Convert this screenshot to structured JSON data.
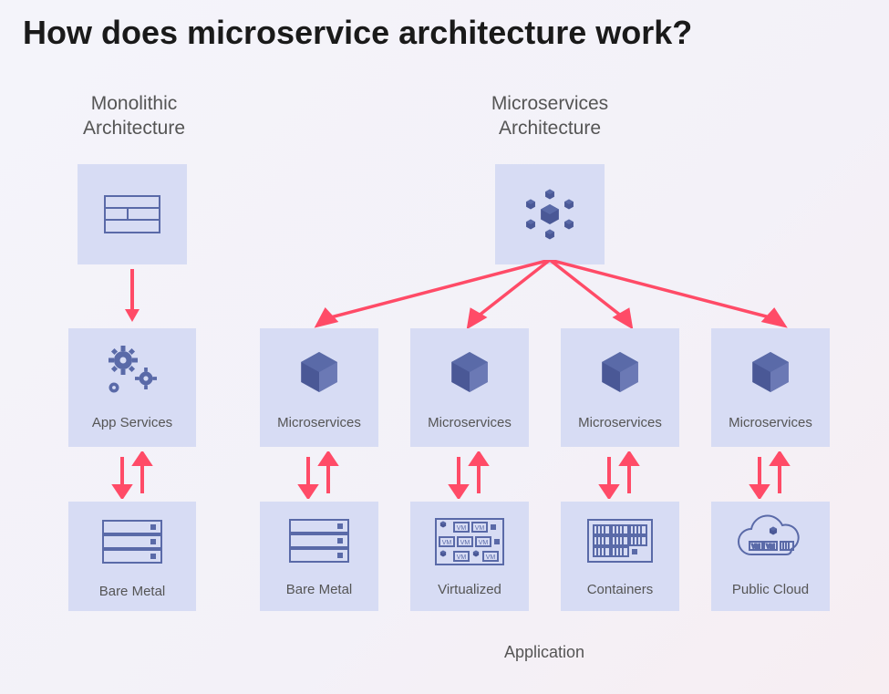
{
  "title": "How does microservice architecture work?",
  "columns": {
    "monolithic_heading_line1": "Monolithic",
    "monolithic_heading_line2": "Architecture",
    "microservices_heading_line1": "Microservices",
    "microservices_heading_line2": "Architecture"
  },
  "monolithic": {
    "app_services_label": "App Services",
    "bare_metal_label": "Bare Metal"
  },
  "micro": {
    "service_labels": [
      "Microservices",
      "Microservices",
      "Microservices",
      "Microservices"
    ],
    "infra_labels": [
      "Bare Metal",
      "Virtualized",
      "Containers",
      "Public Cloud"
    ]
  },
  "footer": "Application"
}
